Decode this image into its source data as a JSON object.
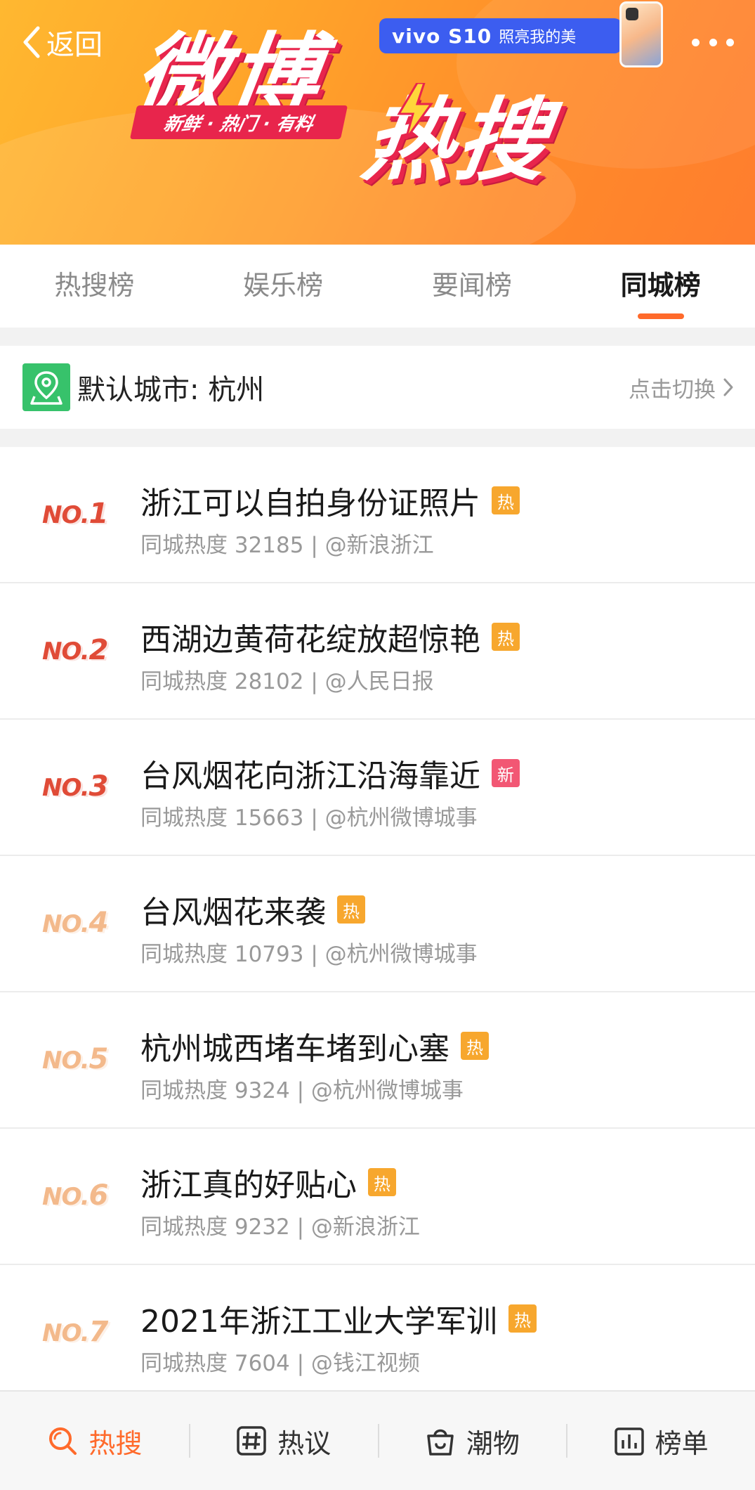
{
  "header": {
    "back_label": "返回",
    "logo_line1": "微博",
    "logo_line2": "热搜",
    "slogan": "新鲜 · 热门 · 有料",
    "ad_brand": "vivo S10",
    "ad_tagline": "照亮我的美"
  },
  "tabs": [
    {
      "label": "热搜榜",
      "active": false
    },
    {
      "label": "娱乐榜",
      "active": false
    },
    {
      "label": "要闻榜",
      "active": false
    },
    {
      "label": "同城榜",
      "active": true
    }
  ],
  "city_bar": {
    "label": "默认城市: 杭州",
    "switch_label": "点击切换"
  },
  "items": [
    {
      "rank_prefix": "NO.",
      "rank": "1",
      "title": "浙江可以自拍身份证照片",
      "badge": "热",
      "badge_type": "hot",
      "meta": "同城热度 32185 | @新浪浙江"
    },
    {
      "rank_prefix": "NO.",
      "rank": "2",
      "title": "西湖边黄荷花绽放超惊艳",
      "badge": "热",
      "badge_type": "hot",
      "meta": "同城热度 28102 | @人民日报"
    },
    {
      "rank_prefix": "NO.",
      "rank": "3",
      "title": "台风烟花向浙江沿海靠近",
      "badge": "新",
      "badge_type": "new",
      "meta": "同城热度 15663 | @杭州微博城事"
    },
    {
      "rank_prefix": "NO.",
      "rank": "4",
      "title": "台风烟花来袭",
      "badge": "热",
      "badge_type": "hot",
      "meta": "同城热度 10793 | @杭州微博城事"
    },
    {
      "rank_prefix": "NO.",
      "rank": "5",
      "title": "杭州城西堵车堵到心塞",
      "badge": "热",
      "badge_type": "hot",
      "meta": "同城热度 9324 | @杭州微博城事"
    },
    {
      "rank_prefix": "NO.",
      "rank": "6",
      "title": "浙江真的好贴心",
      "badge": "热",
      "badge_type": "hot",
      "meta": "同城热度 9232 | @新浪浙江"
    },
    {
      "rank_prefix": "NO.",
      "rank": "7",
      "title": "2021年浙江工业大学军训",
      "badge": "热",
      "badge_type": "hot",
      "meta": "同城热度 7604 | @钱江视频"
    }
  ],
  "bottom_nav": [
    {
      "label": "热搜",
      "icon": "search-icon",
      "active": true
    },
    {
      "label": "热议",
      "icon": "hashtag-icon",
      "active": false
    },
    {
      "label": "潮物",
      "icon": "shopping-bag-icon",
      "active": false
    },
    {
      "label": "榜单",
      "icon": "bar-chart-icon",
      "active": false
    }
  ],
  "colors": {
    "accent": "#ff6a2b",
    "rank_top": "#e04b37",
    "rank_low": "#f3b98b",
    "badge_hot": "#f7a72e",
    "badge_new": "#f25774",
    "city_icon": "#37c26b"
  }
}
